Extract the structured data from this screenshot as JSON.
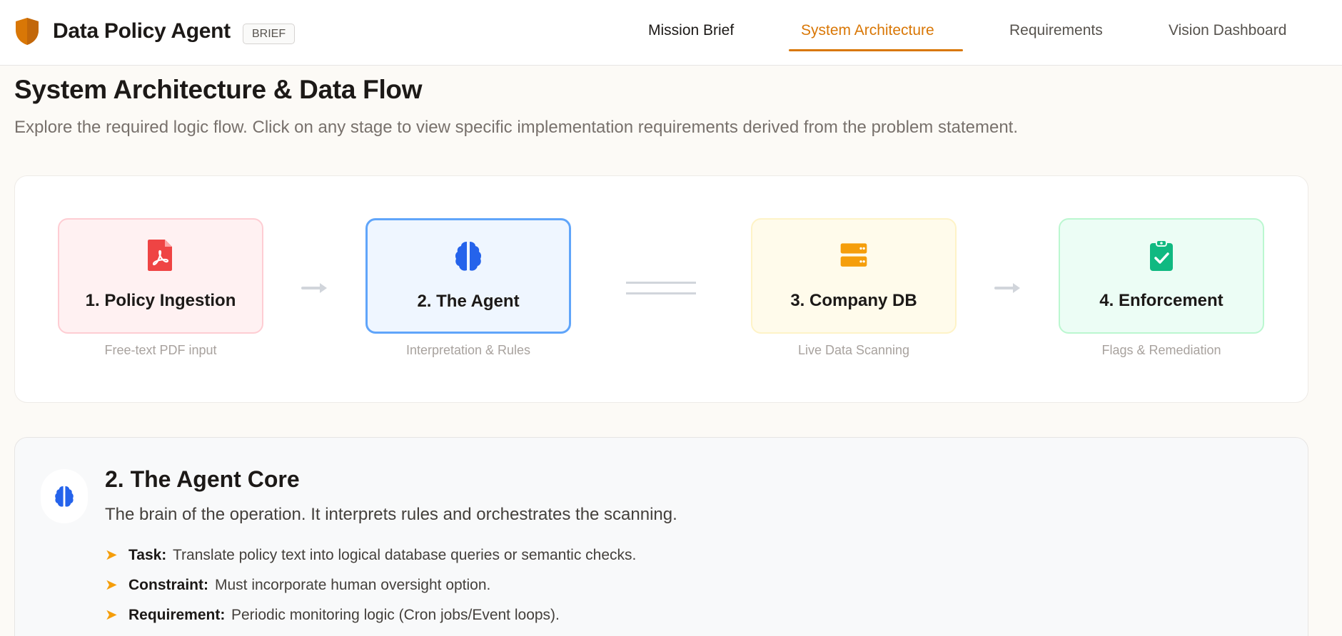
{
  "header": {
    "app_title": "Data Policy Agent",
    "badge": "BRIEF",
    "tabs": [
      {
        "label": "Mission Brief"
      },
      {
        "label": "System Architecture"
      },
      {
        "label": "Requirements"
      },
      {
        "label": "Vision Dashboard"
      }
    ],
    "active_tab": "System Architecture"
  },
  "page": {
    "title": "System Architecture & Data Flow",
    "subtitle": "Explore the required logic flow. Click on any stage to view specific implementation requirements derived from the problem statement."
  },
  "flow": {
    "stages": [
      {
        "title": "1. Policy Ingestion",
        "caption": "Free-text PDF input",
        "icon": "pdf-file-icon",
        "accent": "#ef4444"
      },
      {
        "title": "2. The Agent",
        "caption": "Interpretation & Rules",
        "icon": "brain-icon",
        "accent": "#2563eb"
      },
      {
        "title": "3. Company DB",
        "caption": "Live Data Scanning",
        "icon": "server-icon",
        "accent": "#f59e0b"
      },
      {
        "title": "4. Enforcement",
        "caption": "Flags & Remediation",
        "icon": "clipboard-check-icon",
        "accent": "#10b981"
      }
    ],
    "selected_stage": "2. The Agent"
  },
  "detail": {
    "title": "2. The Agent Core",
    "description": "The brain of the operation. It interprets rules and orchestrates the scanning.",
    "icon": "brain-icon",
    "items": [
      {
        "label": "Task:",
        "text": "Translate policy text into logical database queries or semantic checks."
      },
      {
        "label": "Constraint:",
        "text": "Must incorporate human oversight option."
      },
      {
        "label": "Requirement:",
        "text": "Periodic monitoring logic (Cron jobs/Event loops)."
      }
    ]
  },
  "colors": {
    "brand": "#d97706",
    "bullet_arrow": "#f59e0b"
  }
}
